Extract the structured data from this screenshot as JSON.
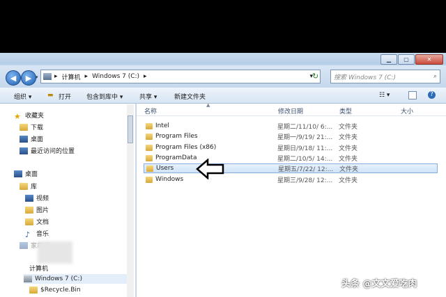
{
  "address": {
    "crumbs": [
      "计算机",
      "Windows 7  (C:)"
    ]
  },
  "search": {
    "placeholder": "搜索 Windows 7  (C:)"
  },
  "toolbar": {
    "organize": "组织 ▾",
    "open": "打开",
    "include": "包含到库中 ▾",
    "share": "共享 ▾",
    "new_folder": "新建文件夹"
  },
  "nav": {
    "favorites": "收藏夹",
    "downloads": "下载",
    "desktop_fav": "桌面",
    "recent": "最近访问的位置",
    "desktop": "桌面",
    "library": "库",
    "videos": "视频",
    "pictures": "图片",
    "documents": "文档",
    "music": "音乐",
    "homegroup": "家庭组",
    "computer": "计算机",
    "drive": "Windows 7  (C:)",
    "recycle": "$Recycle.Bin"
  },
  "columns": {
    "name": "名称",
    "date": "修改日期",
    "type": "类型",
    "size": "大小"
  },
  "files": [
    {
      "name": "Intel",
      "date": "星期二/11/10/ 6:...",
      "type": "文件夹"
    },
    {
      "name": "Program Files",
      "date": "星期一/9/19/ 21:...",
      "type": "文件夹"
    },
    {
      "name": "Program Files (x86)",
      "date": "星期日/9/18/ 11:...",
      "type": "文件夹"
    },
    {
      "name": "ProgramData",
      "date": "星期二/10/5/ 14:...",
      "type": "文件夹"
    },
    {
      "name": "Users",
      "date": "星期五/7/22/ 12:...",
      "type": "文件夹"
    },
    {
      "name": "Windows",
      "date": "星期三/9/28/ 12:...",
      "type": "文件夹"
    }
  ],
  "watermark": "头条 @文文爱吃肉"
}
